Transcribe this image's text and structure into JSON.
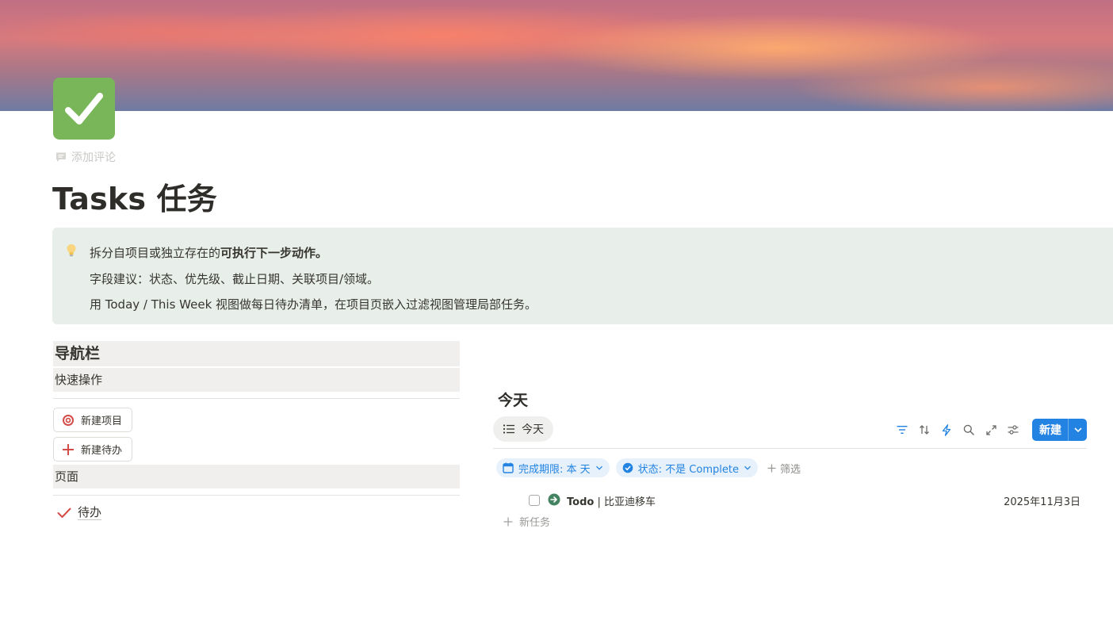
{
  "page": {
    "title": "Tasks 任务",
    "add_comment": "添加评论",
    "icon": "check-mark-icon",
    "icon_color": "#78b659"
  },
  "callout": {
    "icon": "lightbulb-icon",
    "line1_prefix": "拆分自项目或独立存在的",
    "line1_bold": "可执行下一步动作。",
    "line2": "字段建议：状态、优先级、截止日期、关联项目/领域。",
    "line3": "用 Today / This Week 视图做每日待办清单，在项目页嵌入过滤视图管理局部任务。",
    "background": "#e8efea"
  },
  "nav": {
    "heading": "导航栏",
    "quick_actions": "快速操作",
    "buttons": [
      {
        "label": "新建项目",
        "icon": "target-icon"
      },
      {
        "label": "新建待办",
        "icon": "plus-icon"
      }
    ],
    "pages_heading": "页面",
    "links": [
      {
        "label": "待办",
        "icon": "check-icon"
      }
    ]
  },
  "database": {
    "title": "今天",
    "view_tab": "今天",
    "toolbar_icons": [
      "filter-icon",
      "sort-icon",
      "automation-icon",
      "search-icon",
      "expand-icon",
      "settings-icon"
    ],
    "new_button": "新建",
    "accent": "#2383e2",
    "filters": [
      {
        "label": "完成期限: 本 天",
        "icon": "calendar-icon"
      },
      {
        "label": "状态: 不是 Complete",
        "icon": "status-icon"
      }
    ],
    "add_filter": "筛选",
    "rows": [
      {
        "prefix": "Todo",
        "separator": " | ",
        "name": "比亚迪移车",
        "date": "2025年11月3日",
        "checked": false
      }
    ],
    "new_task": "新任务"
  }
}
